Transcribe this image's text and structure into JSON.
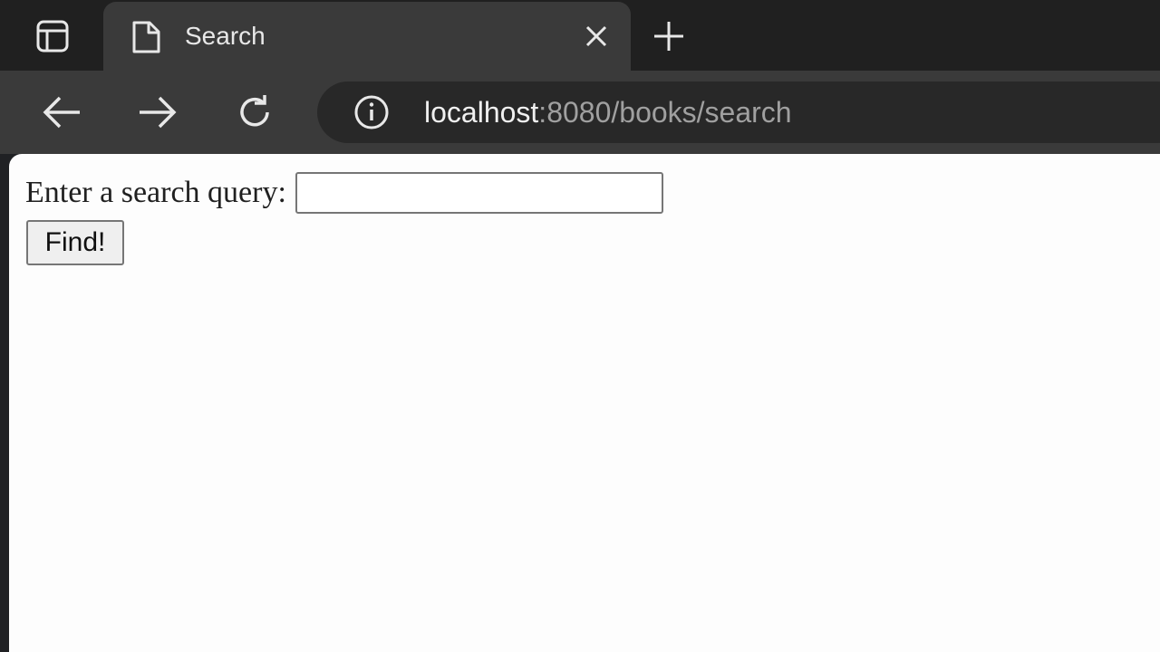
{
  "tab": {
    "title": "Search"
  },
  "address_bar": {
    "host": "localhost",
    "path": ":8080/books/search"
  },
  "page": {
    "label": "Enter a search query:",
    "input_value": "",
    "button_label": "Find!"
  },
  "icons": {
    "sidebar_toggle": "sidebar-toggle-icon",
    "tab_page": "page-icon",
    "tab_close": "close-icon",
    "new_tab": "plus-icon",
    "back": "back-arrow-icon",
    "forward": "forward-arrow-icon",
    "reload": "reload-icon",
    "site_info": "info-icon"
  }
}
